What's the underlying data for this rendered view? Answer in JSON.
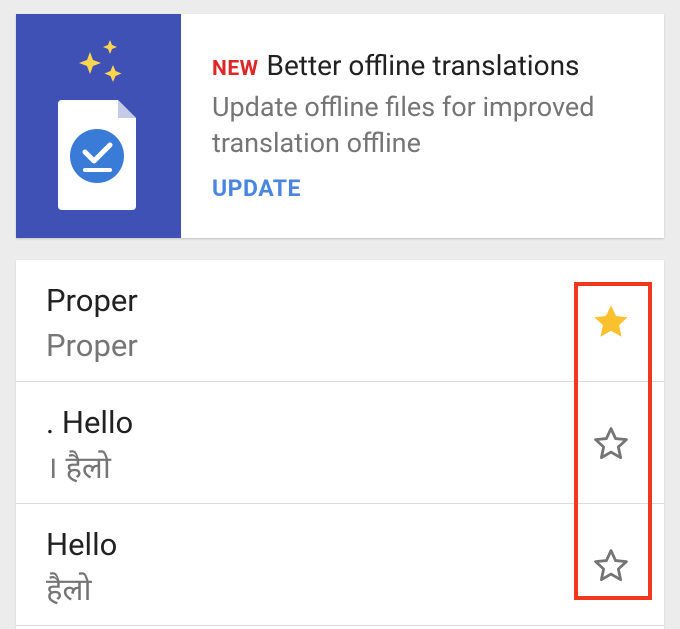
{
  "banner": {
    "badge": "NEW",
    "title": "Better offline translations",
    "description": "Update offline files for improved translation offline",
    "action_label": "UPDATE",
    "art_bg_color": "#3f51b5",
    "badge_color": "#db2828",
    "action_color": "#4a86e0"
  },
  "phrasebook": {
    "items": [
      {
        "source": "Proper",
        "translation": "Proper",
        "starred": true,
        "star_icon": "star-filled-icon"
      },
      {
        "source": ". Hello",
        "translation": "। हैलो",
        "starred": false,
        "star_icon": "star-outline-icon"
      },
      {
        "source": "Hello",
        "translation": "हैलो",
        "starred": false,
        "star_icon": "star-outline-icon"
      }
    ],
    "star_filled_color": "#fbc02d",
    "star_outline_color": "#757575"
  },
  "annotation": {
    "highlight_color": "#f2371f"
  }
}
